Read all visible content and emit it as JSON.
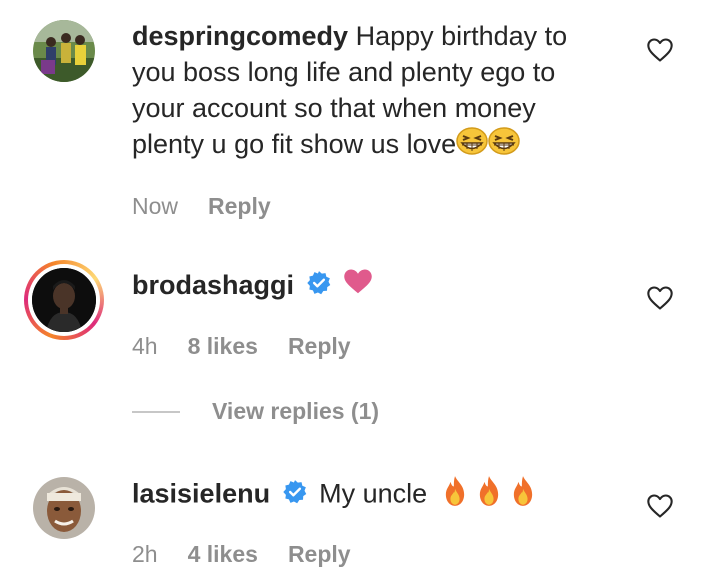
{
  "comments": [
    {
      "username": "despringcomedy",
      "text": "Happy birthday to you boss long life and plenty ego to your account so that when money plenty u go fit show us love",
      "emoji": [
        "grinning-squint-face",
        "grinning-squint-face"
      ],
      "time": "Now",
      "reply": "Reply"
    },
    {
      "username": "brodashaggi",
      "verified": true,
      "emoji": [
        "pink-heart"
      ],
      "time": "4h",
      "likes": "8 likes",
      "reply": "Reply",
      "view_replies": "View replies (1)"
    },
    {
      "username": "lasisielenu",
      "verified": true,
      "text": "My uncle",
      "emoji": [
        "fire",
        "fire",
        "fire"
      ],
      "time": "2h",
      "likes": "4 likes",
      "reply": "Reply"
    }
  ],
  "colors": {
    "text": "#262626",
    "muted": "#8e8e8e",
    "verified": "#3897f0",
    "heart_emoji": "#e05a8c",
    "story_ring": [
      "#f58529",
      "#dd2a7b",
      "#feda77"
    ]
  },
  "icons": {
    "like": "heart-outline-icon",
    "verified": "verified-badge-icon"
  }
}
